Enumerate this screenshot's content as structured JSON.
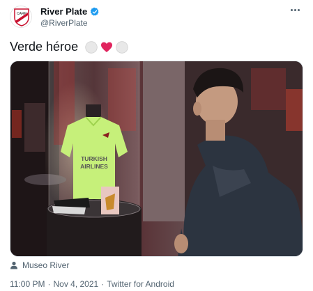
{
  "account": {
    "display_name": "River Plate",
    "handle": "@RiverPlate",
    "verified": true
  },
  "tweet": {
    "text": "Verde héroe",
    "emojis": [
      "white-circle",
      "red-heart",
      "white-circle"
    ]
  },
  "media": {
    "jersey_text_line1": "TURKISH",
    "jersey_text_line2": "AIRLINES"
  },
  "location": {
    "label": "Museo River"
  },
  "meta": {
    "time": "11:00 PM",
    "separator": "·",
    "date": "Nov 4, 2021",
    "app": "Twitter for Android"
  },
  "colors": {
    "verified_blue": "#1d9bf0",
    "secondary_text": "#536471",
    "heart_red": "#e0245e",
    "jersey_green": "#c6f07a"
  }
}
